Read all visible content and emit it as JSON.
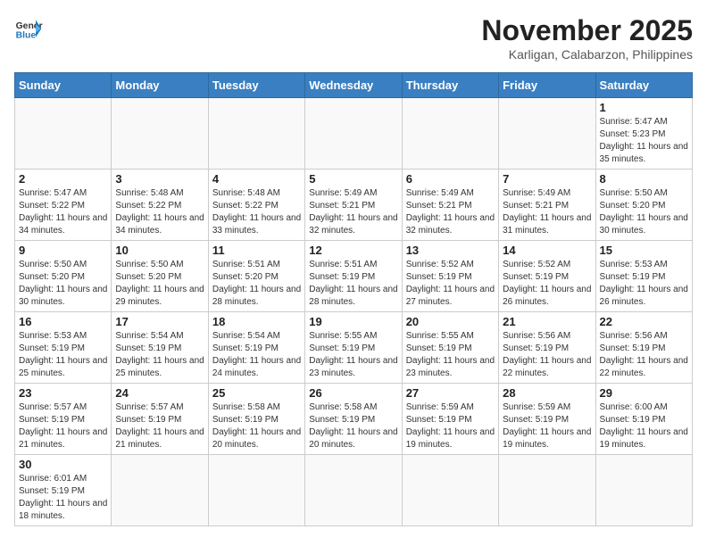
{
  "header": {
    "logo_general": "General",
    "logo_blue": "Blue",
    "month_title": "November 2025",
    "location": "Karligan, Calabarzon, Philippines"
  },
  "weekdays": [
    "Sunday",
    "Monday",
    "Tuesday",
    "Wednesday",
    "Thursday",
    "Friday",
    "Saturday"
  ],
  "weeks": [
    [
      {
        "day": null
      },
      {
        "day": null
      },
      {
        "day": null
      },
      {
        "day": null
      },
      {
        "day": null
      },
      {
        "day": null
      },
      {
        "day": 1,
        "sunrise": "5:47 AM",
        "sunset": "5:23 PM",
        "daylight": "11 hours and 35 minutes."
      }
    ],
    [
      {
        "day": 2,
        "sunrise": "5:47 AM",
        "sunset": "5:22 PM",
        "daylight": "11 hours and 34 minutes."
      },
      {
        "day": 3,
        "sunrise": "5:48 AM",
        "sunset": "5:22 PM",
        "daylight": "11 hours and 34 minutes."
      },
      {
        "day": 4,
        "sunrise": "5:48 AM",
        "sunset": "5:22 PM",
        "daylight": "11 hours and 33 minutes."
      },
      {
        "day": 5,
        "sunrise": "5:49 AM",
        "sunset": "5:21 PM",
        "daylight": "11 hours and 32 minutes."
      },
      {
        "day": 6,
        "sunrise": "5:49 AM",
        "sunset": "5:21 PM",
        "daylight": "11 hours and 32 minutes."
      },
      {
        "day": 7,
        "sunrise": "5:49 AM",
        "sunset": "5:21 PM",
        "daylight": "11 hours and 31 minutes."
      },
      {
        "day": 8,
        "sunrise": "5:50 AM",
        "sunset": "5:20 PM",
        "daylight": "11 hours and 30 minutes."
      }
    ],
    [
      {
        "day": 9,
        "sunrise": "5:50 AM",
        "sunset": "5:20 PM",
        "daylight": "11 hours and 30 minutes."
      },
      {
        "day": 10,
        "sunrise": "5:50 AM",
        "sunset": "5:20 PM",
        "daylight": "11 hours and 29 minutes."
      },
      {
        "day": 11,
        "sunrise": "5:51 AM",
        "sunset": "5:20 PM",
        "daylight": "11 hours and 28 minutes."
      },
      {
        "day": 12,
        "sunrise": "5:51 AM",
        "sunset": "5:19 PM",
        "daylight": "11 hours and 28 minutes."
      },
      {
        "day": 13,
        "sunrise": "5:52 AM",
        "sunset": "5:19 PM",
        "daylight": "11 hours and 27 minutes."
      },
      {
        "day": 14,
        "sunrise": "5:52 AM",
        "sunset": "5:19 PM",
        "daylight": "11 hours and 26 minutes."
      },
      {
        "day": 15,
        "sunrise": "5:53 AM",
        "sunset": "5:19 PM",
        "daylight": "11 hours and 26 minutes."
      }
    ],
    [
      {
        "day": 16,
        "sunrise": "5:53 AM",
        "sunset": "5:19 PM",
        "daylight": "11 hours and 25 minutes."
      },
      {
        "day": 17,
        "sunrise": "5:54 AM",
        "sunset": "5:19 PM",
        "daylight": "11 hours and 25 minutes."
      },
      {
        "day": 18,
        "sunrise": "5:54 AM",
        "sunset": "5:19 PM",
        "daylight": "11 hours and 24 minutes."
      },
      {
        "day": 19,
        "sunrise": "5:55 AM",
        "sunset": "5:19 PM",
        "daylight": "11 hours and 23 minutes."
      },
      {
        "day": 20,
        "sunrise": "5:55 AM",
        "sunset": "5:19 PM",
        "daylight": "11 hours and 23 minutes."
      },
      {
        "day": 21,
        "sunrise": "5:56 AM",
        "sunset": "5:19 PM",
        "daylight": "11 hours and 22 minutes."
      },
      {
        "day": 22,
        "sunrise": "5:56 AM",
        "sunset": "5:19 PM",
        "daylight": "11 hours and 22 minutes."
      }
    ],
    [
      {
        "day": 23,
        "sunrise": "5:57 AM",
        "sunset": "5:19 PM",
        "daylight": "11 hours and 21 minutes."
      },
      {
        "day": 24,
        "sunrise": "5:57 AM",
        "sunset": "5:19 PM",
        "daylight": "11 hours and 21 minutes."
      },
      {
        "day": 25,
        "sunrise": "5:58 AM",
        "sunset": "5:19 PM",
        "daylight": "11 hours and 20 minutes."
      },
      {
        "day": 26,
        "sunrise": "5:58 AM",
        "sunset": "5:19 PM",
        "daylight": "11 hours and 20 minutes."
      },
      {
        "day": 27,
        "sunrise": "5:59 AM",
        "sunset": "5:19 PM",
        "daylight": "11 hours and 19 minutes."
      },
      {
        "day": 28,
        "sunrise": "5:59 AM",
        "sunset": "5:19 PM",
        "daylight": "11 hours and 19 minutes."
      },
      {
        "day": 29,
        "sunrise": "6:00 AM",
        "sunset": "5:19 PM",
        "daylight": "11 hours and 19 minutes."
      }
    ],
    [
      {
        "day": 30,
        "sunrise": "6:01 AM",
        "sunset": "5:19 PM",
        "daylight": "11 hours and 18 minutes."
      },
      {
        "day": null
      },
      {
        "day": null
      },
      {
        "day": null
      },
      {
        "day": null
      },
      {
        "day": null
      },
      {
        "day": null
      }
    ]
  ],
  "labels": {
    "sunrise": "Sunrise:",
    "sunset": "Sunset:",
    "daylight": "Daylight:"
  }
}
